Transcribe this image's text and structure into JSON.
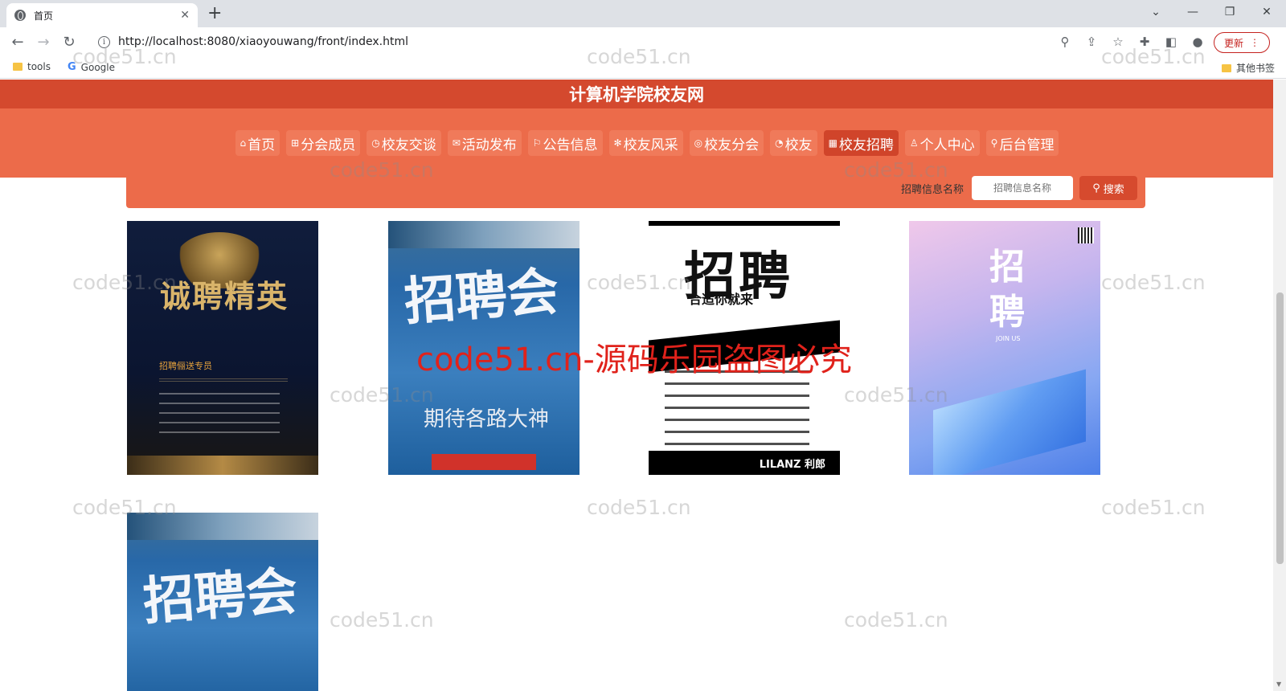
{
  "browser": {
    "tab_title": "首页",
    "url": "http://localhost:8080/xiaoyouwang/front/index.html",
    "update_label": "更新",
    "bookmarks": [
      {
        "label": "tools"
      },
      {
        "label": "Google"
      }
    ],
    "other_bookmarks": "其他书签"
  },
  "site": {
    "title": "计算机学院校友网",
    "nav": [
      {
        "label": "首页",
        "icon": "⌂"
      },
      {
        "label": "分会成员",
        "icon": "⊞"
      },
      {
        "label": "校友交谈",
        "icon": "◷"
      },
      {
        "label": "活动发布",
        "icon": "✉"
      },
      {
        "label": "公告信息",
        "icon": "⚐"
      },
      {
        "label": "校友风采",
        "icon": "✻"
      },
      {
        "label": "校友分会",
        "icon": "◎"
      },
      {
        "label": "校友",
        "icon": "◔"
      },
      {
        "label": "校友招聘",
        "icon": "▦",
        "active": true
      },
      {
        "label": "个人中心",
        "icon": "♙"
      },
      {
        "label": "后台管理",
        "icon": "⚲"
      }
    ],
    "search": {
      "label": "招聘信息名称",
      "placeholder": "招聘信息名称",
      "button": "搜索"
    }
  },
  "posters": [
    {
      "title": "诚聘精英",
      "sub": "招聘俪送专员"
    },
    {
      "title": "招聘会",
      "sub": "期待各路大神"
    },
    {
      "title": "招聘",
      "sub": "合适你就来",
      "footer": "LILANZ 利郎"
    },
    {
      "title": "招聘",
      "sub": "JOIN US"
    },
    {
      "title": "招聘会",
      "sub": ""
    }
  ],
  "watermarks": {
    "small": "code51.cn",
    "red": "code51.cn-源码乐园盗图必究"
  }
}
